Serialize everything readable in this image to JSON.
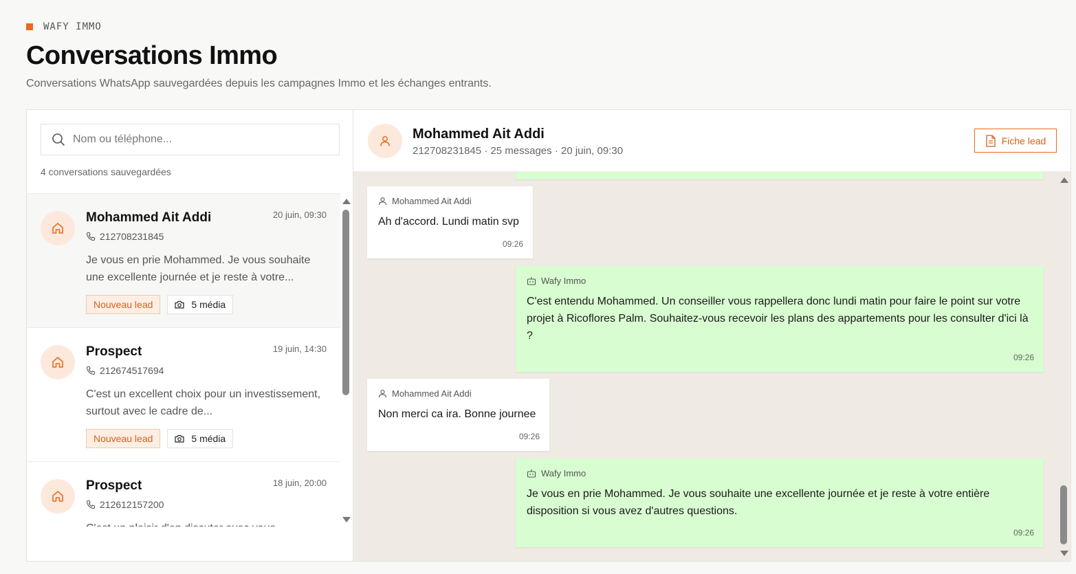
{
  "brand": {
    "name": "WAFY IMMO",
    "accent": "#ea6a1e"
  },
  "page": {
    "title": "Conversations Immo",
    "subtitle": "Conversations WhatsApp sauvegardées depuis les campagnes Immo et les échanges entrants."
  },
  "sidebar": {
    "search_placeholder": "Nom ou téléphone...",
    "count_label": "4 conversations sauvegardées",
    "conversations": [
      {
        "name": "Mohammed Ait Addi",
        "date": "20 juin, 09:30",
        "phone": "212708231845",
        "preview": "Je vous en prie Mohammed. Je vous souhaite une excellente journée et je reste à votre...",
        "tag": "Nouveau lead",
        "media": "5 média",
        "active": true
      },
      {
        "name": "Prospect",
        "date": "19 juin, 14:30",
        "phone": "212674517694",
        "preview": "C'est un excellent choix pour un investissement, surtout avec le cadre de...",
        "tag": "Nouveau lead",
        "media": "5 média",
        "active": false
      },
      {
        "name": "Prospect",
        "date": "18 juin, 20:00",
        "phone": "212612157200",
        "preview": "C'est un plaisir d'en discuter avec vous",
        "tag": "",
        "media": "",
        "active": false
      }
    ]
  },
  "chat": {
    "name": "Mohammed Ait Addi",
    "meta": "212708231845 · 25 messages · 20 juin, 09:30",
    "fiche_button": "Fiche lead",
    "messages": [
      {
        "direction": "in",
        "author": "Mohammed Ait Addi",
        "text": "Ah d'accord. Lundi matin svp",
        "time": "09:26"
      },
      {
        "direction": "out",
        "author": "Wafy Immo",
        "text": "C'est entendu Mohammed. Un conseiller vous rappellera donc lundi matin pour faire le point sur votre projet à Ricoflores Palm. Souhaitez-vous recevoir les plans des appartements pour les consulter d'ici là ?",
        "time": "09:26"
      },
      {
        "direction": "in",
        "author": "Mohammed Ait Addi",
        "text": "Non merci ca ira. Bonne journee",
        "time": "09:26"
      },
      {
        "direction": "out",
        "author": "Wafy Immo",
        "text": "Je vous en prie Mohammed. Je vous souhaite une excellente journée et je reste à votre entière disposition si vous avez d'autres questions.",
        "time": "09:26"
      }
    ]
  }
}
